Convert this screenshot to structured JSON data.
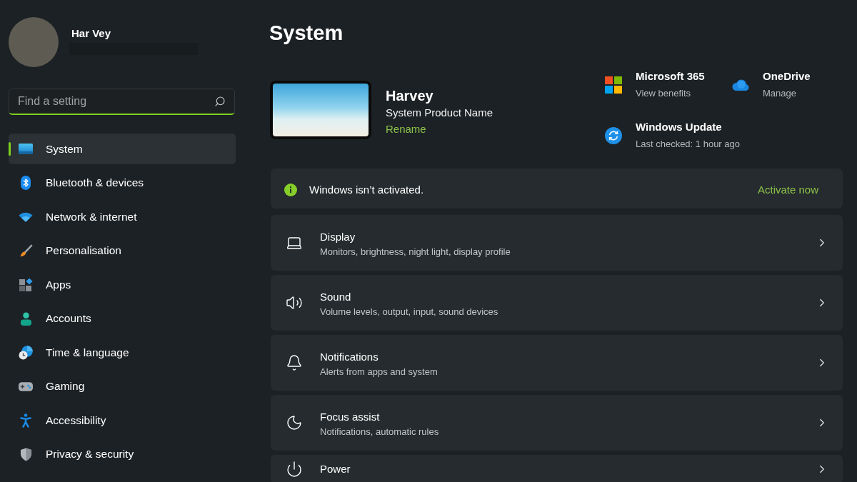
{
  "sidebar": {
    "user": {
      "name": "Har Vey"
    },
    "search": {
      "placeholder": "Find a setting"
    },
    "nav_items": [
      {
        "kind": "system",
        "label": "System",
        "selected": true
      },
      {
        "kind": "bluetooth",
        "label": "Bluetooth & devices",
        "selected": false
      },
      {
        "kind": "network",
        "label": "Network & internet",
        "selected": false
      },
      {
        "kind": "brush",
        "label": "Personalisation",
        "selected": false
      },
      {
        "kind": "apps",
        "label": "Apps",
        "selected": false
      },
      {
        "kind": "accounts",
        "label": "Accounts",
        "selected": false
      },
      {
        "kind": "time",
        "label": "Time & language",
        "selected": false
      },
      {
        "kind": "gaming",
        "label": "Gaming",
        "selected": false
      },
      {
        "kind": "accessibility",
        "label": "Accessibility",
        "selected": false
      },
      {
        "kind": "privacy",
        "label": "Privacy & security",
        "selected": false
      }
    ]
  },
  "page": {
    "title": "System"
  },
  "device": {
    "name": "Harvey",
    "model": "System Product Name",
    "rename": "Rename"
  },
  "services": [
    {
      "kind": "squares",
      "title": "Microsoft 365",
      "subtitle": "View benefits"
    },
    {
      "kind": "cloud",
      "title": "OneDrive",
      "subtitle": "Manage"
    },
    {
      "kind": "update",
      "title": "Windows Update",
      "subtitle": "Last checked: 1 hour ago"
    }
  ],
  "activation": {
    "message": "Windows isn’t activated.",
    "action": "Activate now"
  },
  "cards": [
    {
      "kind": "display",
      "title": "Display",
      "subtitle": "Monitors, brightness, night light, display profile"
    },
    {
      "kind": "sound",
      "title": "Sound",
      "subtitle": "Volume levels, output, input, sound devices"
    },
    {
      "kind": "notifications",
      "title": "Notifications",
      "subtitle": "Alerts from apps and system"
    },
    {
      "kind": "focus",
      "title": "Focus assist",
      "subtitle": "Notifications, automatic rules"
    },
    {
      "kind": "power",
      "title": "Power"
    }
  ]
}
